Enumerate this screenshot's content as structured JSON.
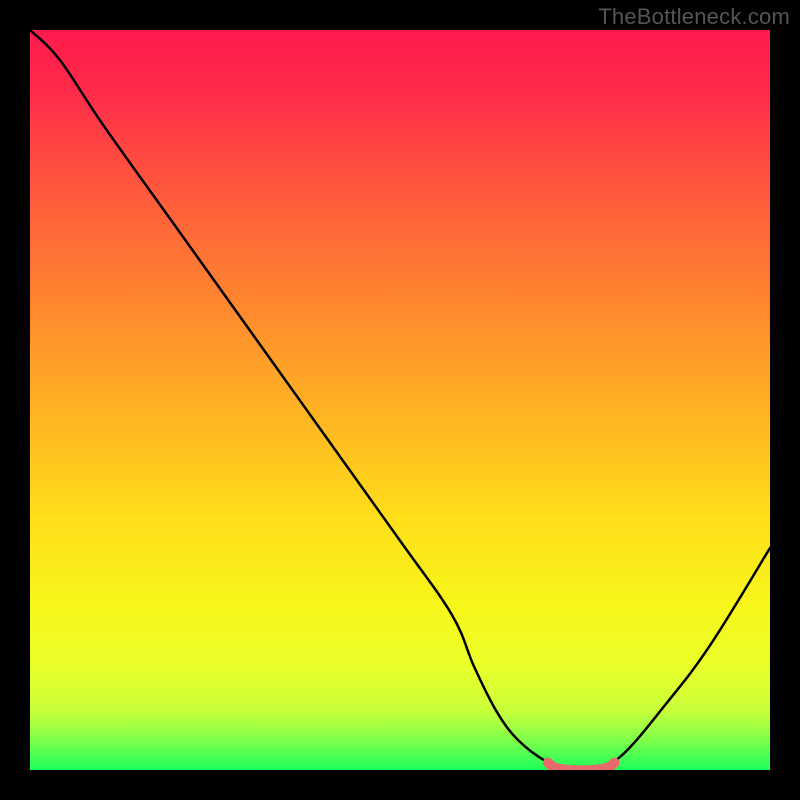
{
  "watermark": "TheBottleneck.com",
  "chart_data": {
    "type": "line",
    "title": "",
    "xlabel": "",
    "ylabel": "",
    "xlim": [
      0,
      100
    ],
    "ylim": [
      0,
      100
    ],
    "series": [
      {
        "name": "bottleneck-curve",
        "x": [
          0,
          4,
          10,
          20,
          30,
          40,
          50,
          57,
          60,
          63,
          66,
          70,
          73,
          76,
          80,
          86,
          92,
          100
        ],
        "values": [
          100,
          96,
          87,
          73,
          59,
          45,
          31,
          21,
          14,
          8,
          4,
          1,
          0,
          0,
          2,
          9,
          17,
          30
        ]
      },
      {
        "name": "highlight-segment",
        "x": [
          70,
          71,
          73,
          76,
          78,
          79
        ],
        "values": [
          1,
          0.3,
          0,
          0,
          0.3,
          1
        ]
      }
    ],
    "gradient_stops": [
      {
        "offset": 0.0,
        "color": "#ff1a4d"
      },
      {
        "offset": 0.08,
        "color": "#ff2a4a"
      },
      {
        "offset": 0.22,
        "color": "#ff5a3c"
      },
      {
        "offset": 0.38,
        "color": "#ff8a2e"
      },
      {
        "offset": 0.52,
        "color": "#ffb422"
      },
      {
        "offset": 0.66,
        "color": "#ffde1a"
      },
      {
        "offset": 0.78,
        "color": "#f7f71a"
      },
      {
        "offset": 0.86,
        "color": "#eaff2a"
      },
      {
        "offset": 0.92,
        "color": "#c8ff3a"
      },
      {
        "offset": 0.96,
        "color": "#7dff4a"
      },
      {
        "offset": 1.0,
        "color": "#1cff5a"
      }
    ],
    "highlight_color": "#e86a6a",
    "curve_color": "#000000"
  }
}
